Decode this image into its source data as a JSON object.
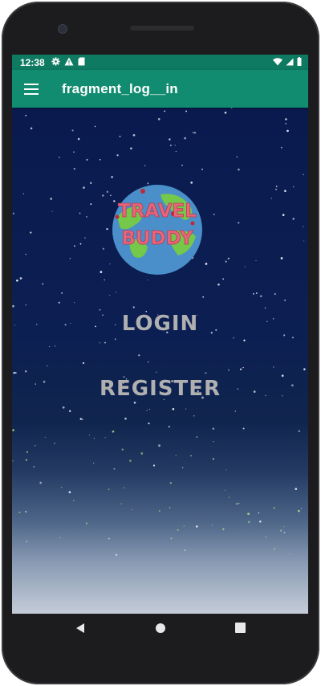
{
  "status_bar": {
    "time": "12:38",
    "left_icons": [
      "gear-icon",
      "warning-icon",
      "sd-card-icon"
    ],
    "right_icons": [
      "wifi-icon",
      "signal-icon",
      "battery-icon"
    ]
  },
  "app_bar": {
    "title": "fragment_log__in",
    "menu_icon": "hamburger-menu-icon",
    "color": "#128c70"
  },
  "logo": {
    "line1": "TRAVEL",
    "line2": "BUDDY"
  },
  "buttons": {
    "login": "LOGIN",
    "register": "REGISTER"
  },
  "nav_bar": {
    "icons": [
      "back-icon",
      "home-icon",
      "recents-icon"
    ]
  }
}
